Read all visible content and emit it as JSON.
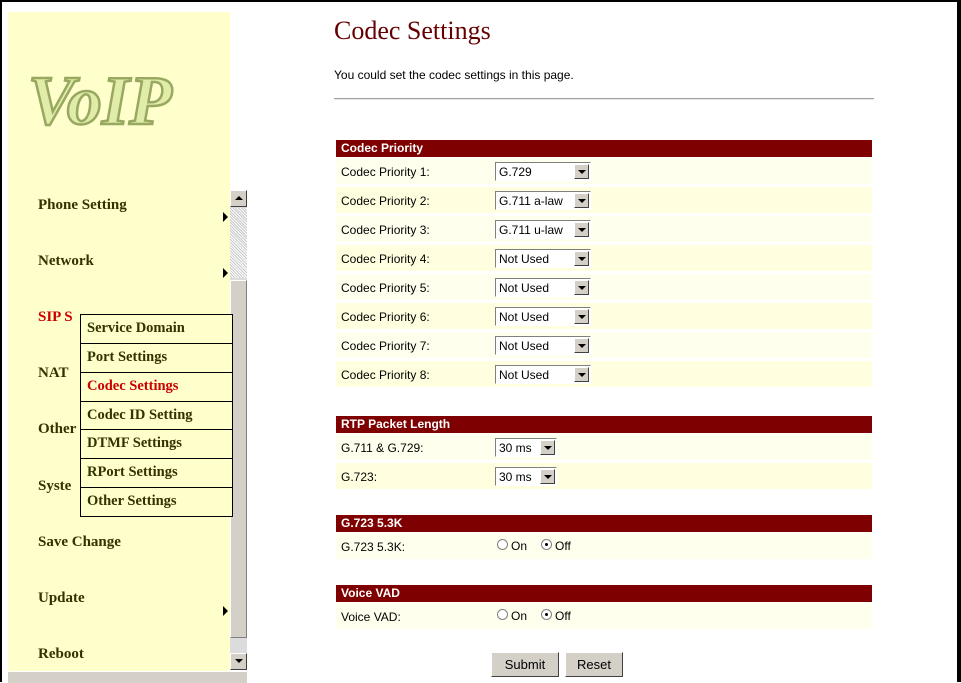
{
  "logo_text": "VoIP",
  "nav": {
    "items": [
      {
        "label": "Phone Setting"
      },
      {
        "label": "Network"
      },
      {
        "label": "SIP S"
      },
      {
        "label": "NAT"
      },
      {
        "label": "Other"
      },
      {
        "label": "Syste"
      },
      {
        "label": "Save Change"
      },
      {
        "label": "Update"
      },
      {
        "label": "Reboot"
      }
    ],
    "submenu": [
      "Service Domain",
      "Port Settings",
      "Codec Settings",
      "Codec ID Setting",
      "DTMF Settings",
      "RPort Settings",
      "Other Settings"
    ]
  },
  "page": {
    "title": "Codec Settings",
    "description": "You could set the codec settings in this page."
  },
  "codec_priority": {
    "header": "Codec Priority",
    "rows": [
      {
        "label": "Codec Priority 1:",
        "value": "G.729"
      },
      {
        "label": "Codec Priority 2:",
        "value": "G.711 a-law"
      },
      {
        "label": "Codec Priority 3:",
        "value": "G.711 u-law"
      },
      {
        "label": "Codec Priority 4:",
        "value": "Not Used"
      },
      {
        "label": "Codec Priority 5:",
        "value": "Not Used"
      },
      {
        "label": "Codec Priority 6:",
        "value": "Not Used"
      },
      {
        "label": "Codec Priority 7:",
        "value": "Not Used"
      },
      {
        "label": "Codec Priority 8:",
        "value": "Not Used"
      }
    ]
  },
  "rtp": {
    "header": "RTP Packet Length",
    "rows": [
      {
        "label": "G.711 & G.729:",
        "value": "30 ms"
      },
      {
        "label": "G.723:",
        "value": "30 ms"
      }
    ]
  },
  "g723": {
    "header": "G.723 5.3K",
    "label": "G.723 5.3K:",
    "on": "On",
    "off": "Off",
    "selected": "Off"
  },
  "vad": {
    "header": "Voice VAD",
    "label": "Voice VAD:",
    "on": "On",
    "off": "Off",
    "selected": "Off"
  },
  "buttons": {
    "submit": "Submit",
    "reset": "Reset"
  },
  "colors": {
    "section_header": "#7f0000",
    "sidebar_bg": "#ffffcc",
    "title": "#660000",
    "active_nav": "#cc0000"
  }
}
